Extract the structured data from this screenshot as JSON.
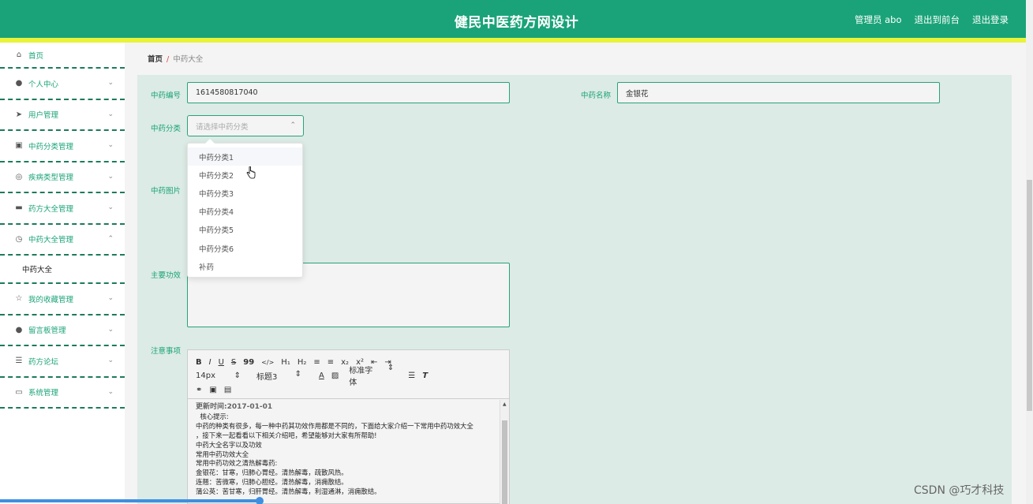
{
  "header": {
    "title": "健民中医药方网设计",
    "admin": "管理员 abo",
    "back_front": "退出到前台",
    "logout": "退出登录"
  },
  "sidebar": {
    "items": [
      {
        "label": "首页",
        "icon": "home-icon"
      },
      {
        "label": "个人中心",
        "icon": "user-icon"
      },
      {
        "label": "用户管理",
        "icon": "send-icon"
      },
      {
        "label": "中药分类管理",
        "icon": "clipboard-icon"
      },
      {
        "label": "疾病类型管理",
        "icon": "circle-icon"
      },
      {
        "label": "药方大全管理",
        "icon": "message-icon"
      },
      {
        "label": "中药大全管理",
        "icon": "compass-icon"
      },
      {
        "label": "中药大全",
        "icon": ""
      },
      {
        "label": "我的收藏管理",
        "icon": "star-off-icon"
      },
      {
        "label": "留言板管理",
        "icon": "user-icon"
      },
      {
        "label": "药方论坛",
        "icon": "list-icon"
      },
      {
        "label": "系统管理",
        "icon": "menu-icon"
      }
    ]
  },
  "breadcrumb": {
    "home": "首页",
    "sep": "/",
    "current": "中药大全"
  },
  "form": {
    "code_label": "中药编号",
    "code_value": "1614580817040",
    "name_label": "中药名称",
    "name_value": "金银花",
    "category_label": "中药分类",
    "category_placeholder": "请选择中药分类",
    "image_label": "中药图片",
    "effect_label": "主要功效",
    "notes_label": "注意事项"
  },
  "dropdown_options": [
    "中药分类1",
    "中药分类2",
    "中药分类3",
    "中药分类4",
    "中药分类5",
    "中药分类6",
    "补药"
  ],
  "editor": {
    "row1": [
      "B",
      "I",
      "U",
      "S",
      "99",
      "</>",
      "H₁",
      "H₂",
      "≡",
      "≡",
      "x₂",
      "x²",
      "⇤",
      "⇥"
    ],
    "font_size": "14px",
    "heading": "标题3",
    "font_family": "标准字体",
    "content": [
      "更新时间:2017-01-01",
      "  核心提示:",
      "中药的种类有很多，每一种中药其功效作用都是不同的，下面给大家介绍一下常用中药功效大全",
      "，接下来一起看看以下相关介绍吧，希望能够对大家有所帮助!",
      "中药大全名字以及功效",
      "常用中药功效大全",
      "常用中药功效之清热解毒药:",
      "金银花：甘寒，归肺心胃经。清热解毒，疏散风热。",
      "连翘：苦微寒，归肺心胆经。清热解毒，消痈散结。",
      "蒲公英：苦甘寒，归肝胃经。清热解毒，利湿通淋，消痈散结。"
    ]
  },
  "watermark": "CSDN @巧才科技"
}
